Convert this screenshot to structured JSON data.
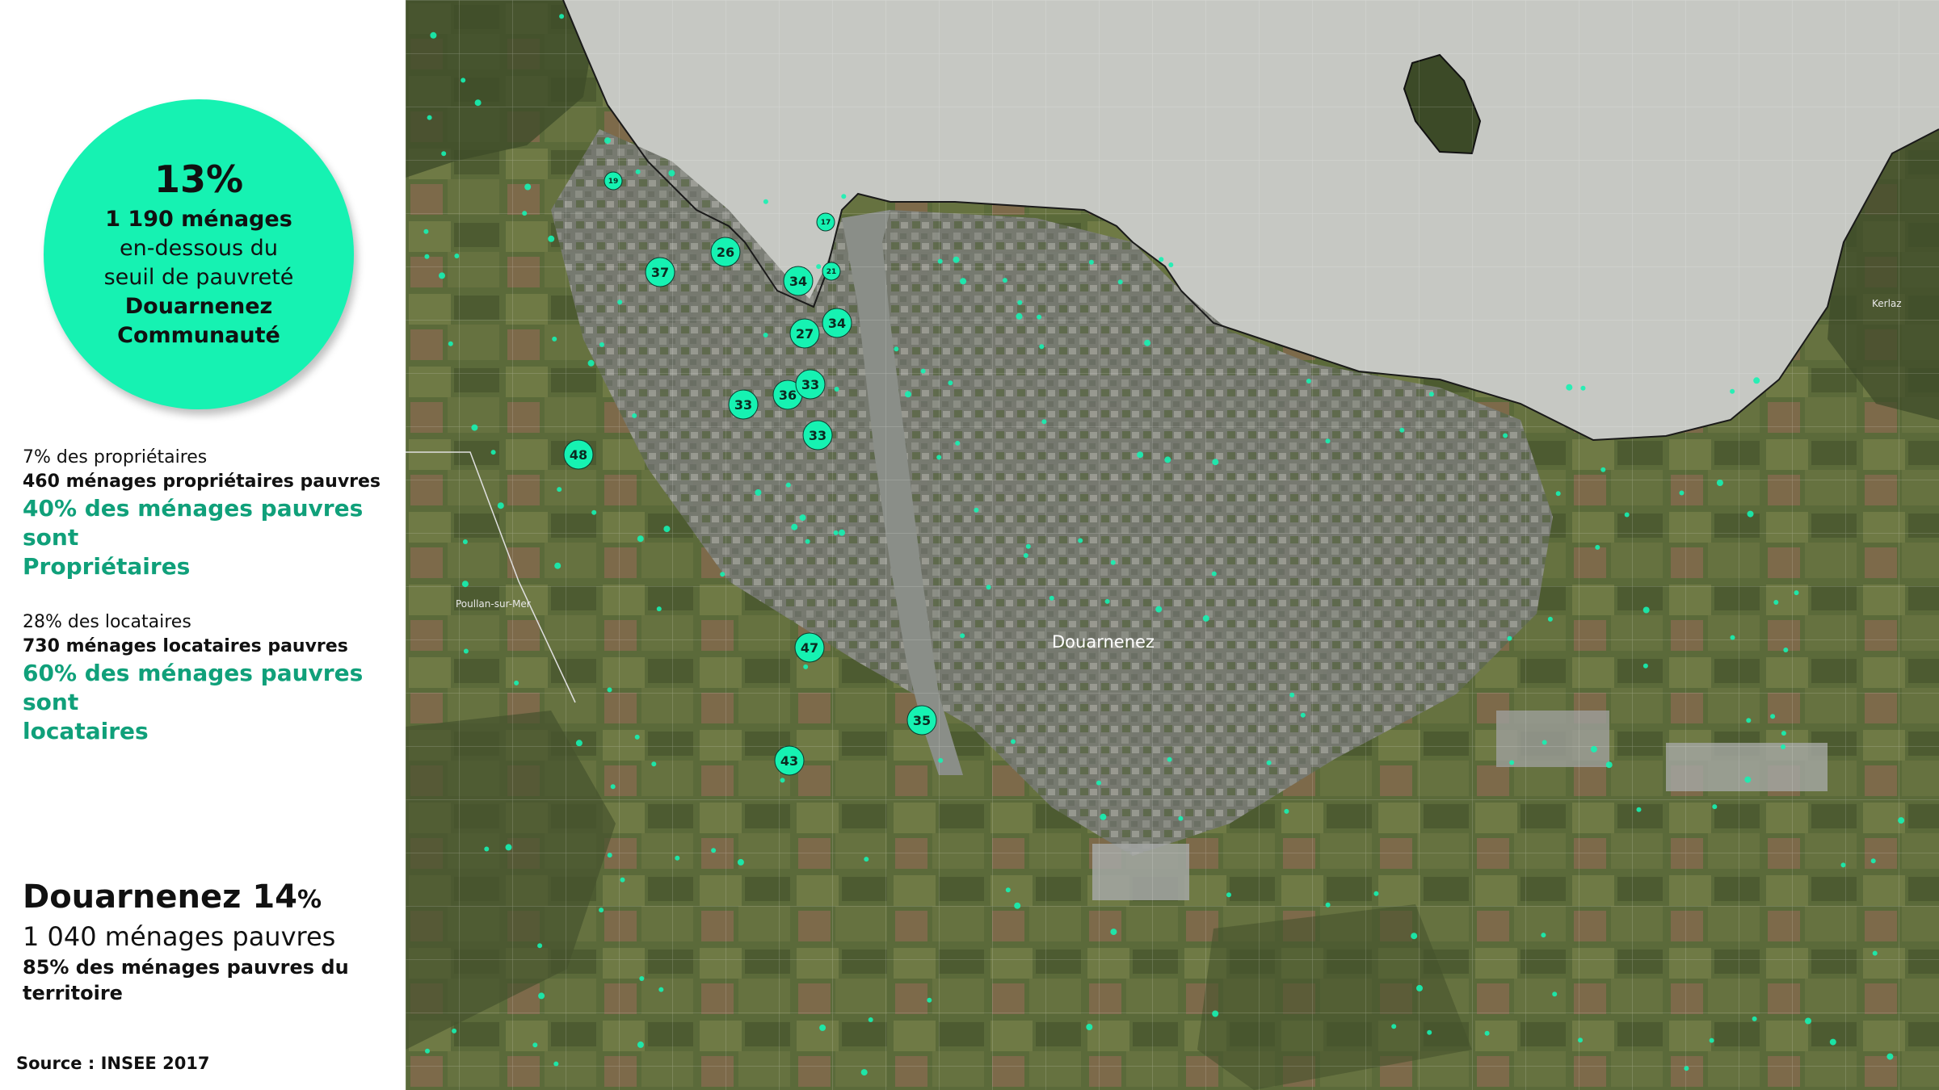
{
  "summary": {
    "percentage": "13%",
    "households": "1 190 ménages",
    "line2": "en-dessous du",
    "line3": "seuil de pauvreté",
    "territory_line1": "Douarnenez",
    "territory_line2": "Communauté"
  },
  "owners": {
    "share": "7% des propriétaires",
    "count": "460 ménages propriétaires pauvres",
    "highlight_line1": "40% des ménages pauvres",
    "highlight_line2": "sont",
    "highlight_line3": "Propriétaires"
  },
  "tenants": {
    "share": "28% des locataires",
    "count": "730 ménages locataires pauvres",
    "highlight_line1": "60% des ménages pauvres",
    "highlight_line2": "sont",
    "highlight_line3": "locataires"
  },
  "town": {
    "name": "Douarnenez",
    "percentage": "14",
    "percent_sign": "%",
    "households": "1 040 ménages pauvres",
    "note": "85% des ménages pauvres du territoire"
  },
  "source": "Source : INSEE 2017",
  "map": {
    "labels": {
      "town": "Douarnenez",
      "village_west": "Poullan-sur-Mer",
      "village_east": "Kerlaz"
    },
    "accent_color": "#16f2b2",
    "large_markers": [
      "48",
      "37",
      "26",
      "34",
      "27",
      "34",
      "33",
      "36",
      "33",
      "33",
      "47",
      "35",
      "43",
      "19",
      "17",
      "21"
    ]
  }
}
